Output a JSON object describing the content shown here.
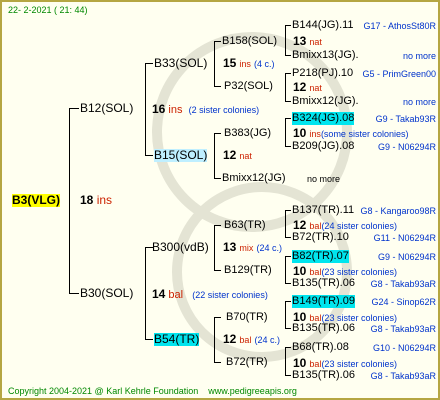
{
  "header": {
    "date": "22-  2-2021  ( 21: 44)"
  },
  "footer": {
    "copyright": "Copyright 2004-2021 @ Karl Kehrle Foundation",
    "site": "www.pedigreeapis.org"
  },
  "root": {
    "name": "B3(VLG)",
    "num": "18",
    "suffix": "ins"
  },
  "gen1": {
    "upper": {
      "name": "B12(SOL)",
      "num": "16",
      "suffix": "ins",
      "note": "(2 sister colonies)"
    },
    "lower": {
      "name": "B30(SOL)",
      "num": "14",
      "suffix": "bal",
      "note": "(22 sister colonies)"
    }
  },
  "gen2": {
    "a": {
      "name": "B33(SOL)",
      "num": "15",
      "suffix": "ins",
      "note": "(4 c.)"
    },
    "b": {
      "name": "B15(SOL)",
      "num": "12",
      "suffix": "nat"
    },
    "c": {
      "name": "B300(vdB)",
      "num": "13",
      "suffix": "mix",
      "note": "(24 c.)"
    },
    "d": {
      "name": "B54(TR)",
      "num": "12",
      "suffix": "bal",
      "note": "(24 c.)"
    }
  },
  "gen3": {
    "a": {
      "name": "B158(SOL)",
      "num": "13",
      "suffix": "nat"
    },
    "b": {
      "name": "P32(SOL)",
      "num": "12",
      "suffix": "nat"
    },
    "c": {
      "name": "B383(JG)",
      "num": "10",
      "suffix": "ins",
      "note": "(some sister colonies)"
    },
    "d": {
      "name": "Bmixx12(JG)",
      "note": "no more"
    },
    "e": {
      "name": "B63(TR)",
      "num": "12",
      "suffix": "bal",
      "note": "(24 sister colonies)"
    },
    "f": {
      "name": "B129(TR)",
      "num": "10",
      "suffix": "bal",
      "note": "(23 sister colonies)"
    },
    "g": {
      "name": "B70(TR)",
      "num": "10",
      "suffix": "bal",
      "note": "(23 sister colonies)"
    },
    "h": {
      "name": "B72(TR)",
      "num": "10",
      "suffix": "bal",
      "note": "(23 sister colonies)"
    }
  },
  "gen4": [
    {
      "name": "B144(JG).11",
      "code": "G17 - AthosSt80R"
    },
    {
      "name": "Bmixx13(JG).",
      "code": "no more"
    },
    {
      "name": "P218(PJ).10",
      "code": "G5 - PrimGreen00"
    },
    {
      "name": "Bmixx12(JG).",
      "code": "no more"
    },
    {
      "name": "B324(JG).08",
      "code": "G9 - Takab93R"
    },
    {
      "name": "B209(JG).08",
      "code": "G9 - N06294R"
    },
    {
      "name": "B137(TR).11",
      "code": "G8 - Kangaroo98R"
    },
    {
      "name": "B72(TR).10",
      "code": "G11 - N06294R"
    },
    {
      "name": "B82(TR).07",
      "code": "G9 - N06294R"
    },
    {
      "name": "B135(TR).06",
      "code": "G8 - Takab93aR"
    },
    {
      "name": "B149(TR).09",
      "code": "G24 - Sinop62R"
    },
    {
      "name": "B135(TR).06",
      "code": "G8 - Takab93aR"
    },
    {
      "name": "B68(TR).08",
      "code": "G10 - N06294R"
    },
    {
      "name": "B135(TR).06",
      "code": "G8 - Takab93aR"
    }
  ]
}
